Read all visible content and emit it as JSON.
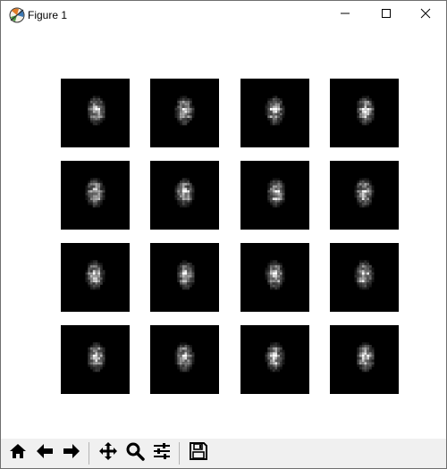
{
  "window": {
    "title": "Figure 1",
    "icons": {
      "app": "matplotlib-icon",
      "minimize": "minimize-icon",
      "maximize": "maximize-icon",
      "close": "close-icon"
    }
  },
  "figure": {
    "grid_rows": 4,
    "grid_cols": 4,
    "image_count": 16,
    "description_colors": {
      "image_background": "#000000",
      "canvas_background": "#ffffff"
    }
  },
  "toolbar": {
    "buttons": [
      {
        "name": "home-button",
        "icon": "home-icon"
      },
      {
        "name": "back-button",
        "icon": "arrow-left-icon"
      },
      {
        "name": "forward-button",
        "icon": "arrow-right-icon"
      },
      {
        "name": "pan-button",
        "icon": "move-icon"
      },
      {
        "name": "zoom-button",
        "icon": "magnifier-icon"
      },
      {
        "name": "subplots-button",
        "icon": "sliders-icon"
      },
      {
        "name": "save-button",
        "icon": "floppy-icon"
      }
    ]
  }
}
